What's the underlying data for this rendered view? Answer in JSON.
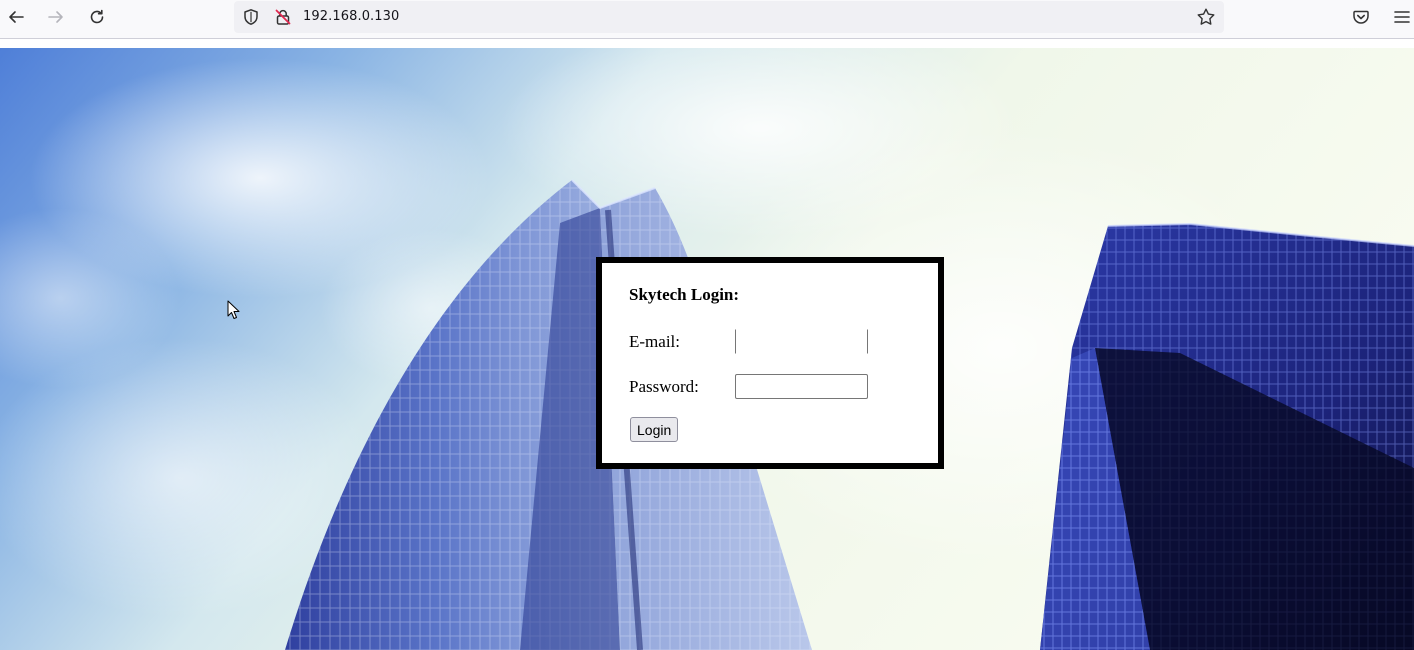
{
  "browser": {
    "url": "192.168.0.130",
    "icons": {
      "back": "back-arrow-icon",
      "forward": "forward-arrow-icon",
      "reload": "reload-icon",
      "tracking": "tracking-protection-icon",
      "insecure": "insecure-lock-icon",
      "bookmark": "bookmark-star-icon",
      "pocket": "pocket-icon",
      "menu": "hamburger-menu-icon"
    }
  },
  "login": {
    "title": "Skytech Login:",
    "email_label": "E-mail:",
    "email_value": "",
    "password_label": "Password:",
    "password_value": "",
    "button_label": "Login"
  },
  "colors": {
    "sky_blue": "#5f8fdc",
    "cloud_white": "#f3f9ee",
    "building_blue": "#2b3fa8",
    "box_border": "#000000"
  }
}
